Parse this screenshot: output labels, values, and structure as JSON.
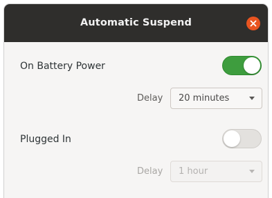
{
  "window": {
    "title": "Automatic Suspend",
    "close_icon": "close-icon"
  },
  "battery": {
    "label": "On Battery Power",
    "enabled": true,
    "delay_label": "Delay",
    "delay_value": "20 minutes"
  },
  "plugged": {
    "label": "Plugged In",
    "enabled": false,
    "delay_label": "Delay",
    "delay_value": "1 hour"
  },
  "colors": {
    "titlebar": "#2f2e2c",
    "close_button": "#e95420",
    "switch_on": "#3e9d3e",
    "switch_off": "#e3e1de",
    "dialog_background": "#f6f5f4"
  }
}
